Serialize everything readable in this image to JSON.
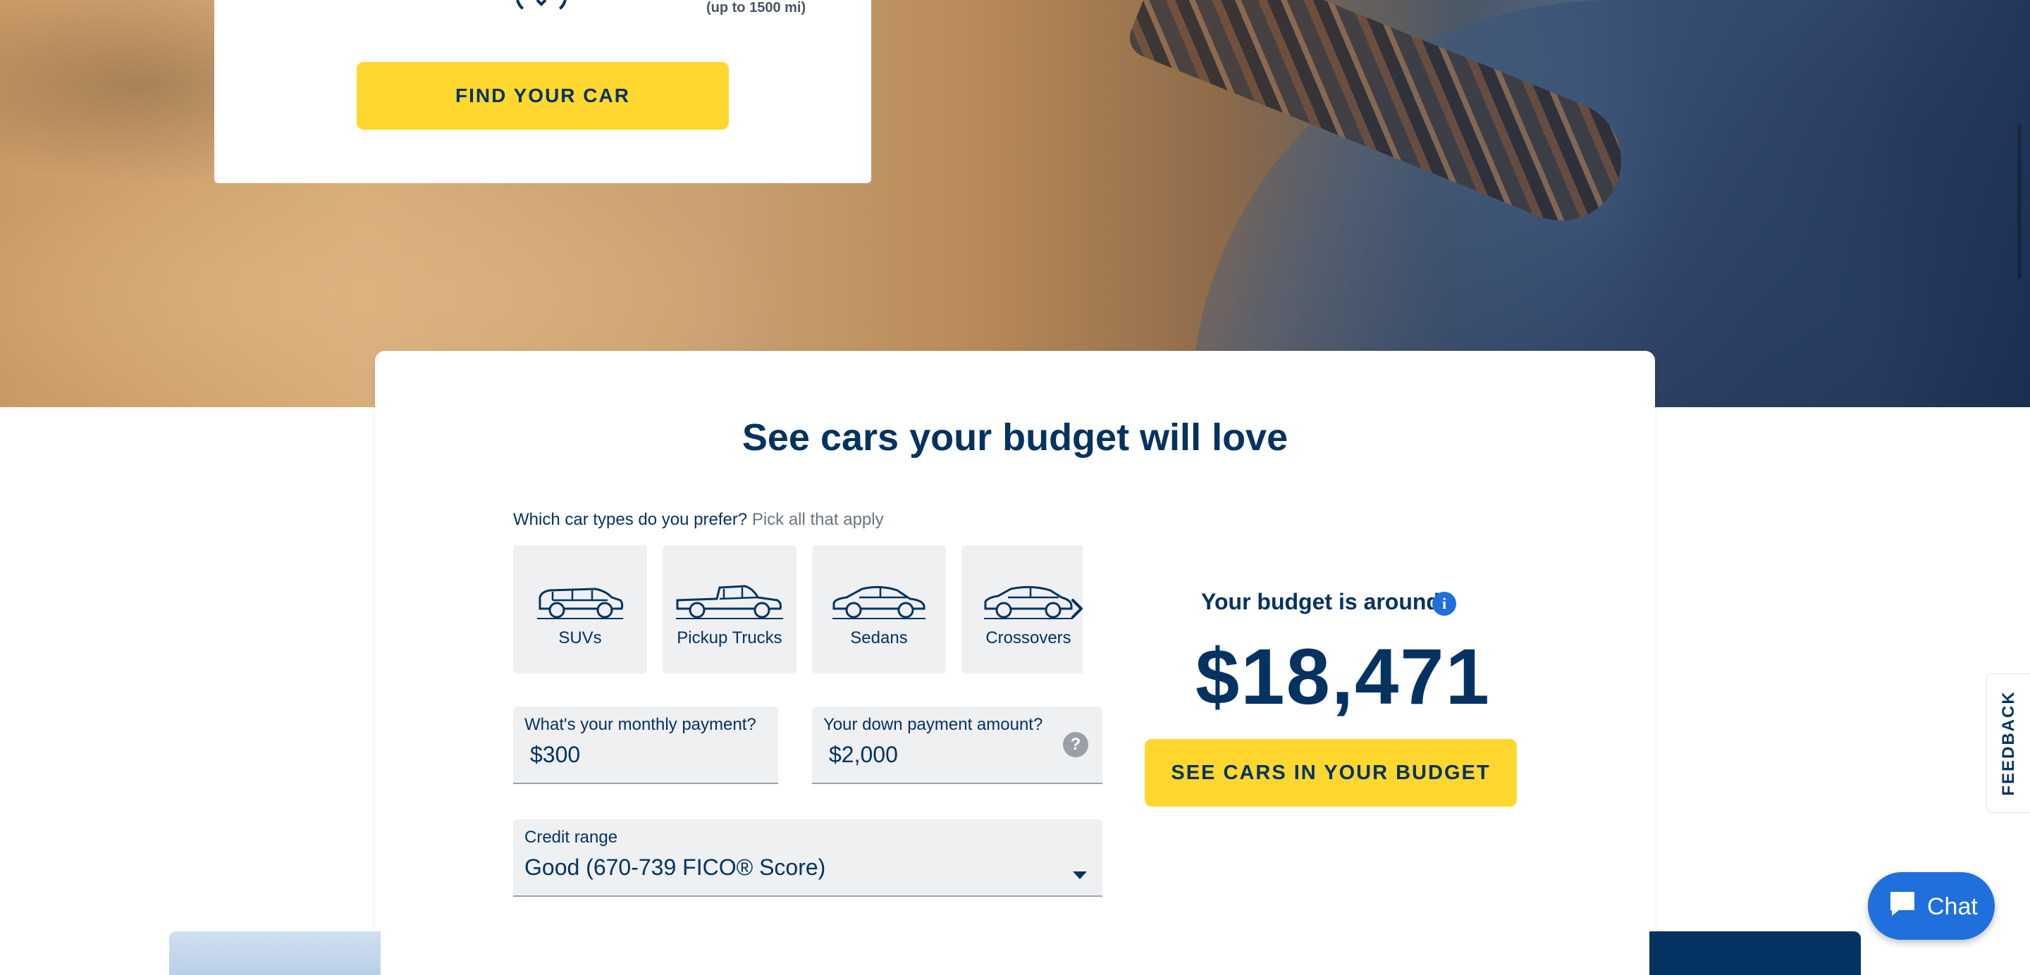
{
  "search_card": {
    "range_note": "(up to 1500 mi)",
    "find_button": "FIND YOUR CAR"
  },
  "budget": {
    "title": "See cars your budget will love",
    "prefer_question": "Which car types do you prefer?",
    "prefer_hint": "Pick all that apply",
    "car_types": [
      {
        "label": "SUVs",
        "icon": "suv-icon"
      },
      {
        "label": "Pickup Trucks",
        "icon": "pickup-truck-icon"
      },
      {
        "label": "Sedans",
        "icon": "sedan-icon"
      },
      {
        "label": "Crossovers",
        "icon": "crossover-icon"
      }
    ],
    "monthly_payment": {
      "label": "What's your monthly payment?",
      "value": "$300"
    },
    "down_payment": {
      "label": "Your down payment amount?",
      "value": "$2,000",
      "help": "?"
    },
    "credit_range": {
      "label": "Credit range",
      "value": "Good (670-739 FICO® Score)"
    },
    "result_label": "Your budget is around",
    "info_glyph": "i",
    "amount": "$18,471",
    "see_button": "SEE CARS IN YOUR BUDGET"
  },
  "feedback_tab": "FEEDBACK",
  "chat": {
    "label": "Chat"
  },
  "colors": {
    "brand_navy": "#053361",
    "accent_yellow": "#ffd72f",
    "info_blue": "#1f6fdc",
    "tile_gray": "#eef0f2"
  }
}
